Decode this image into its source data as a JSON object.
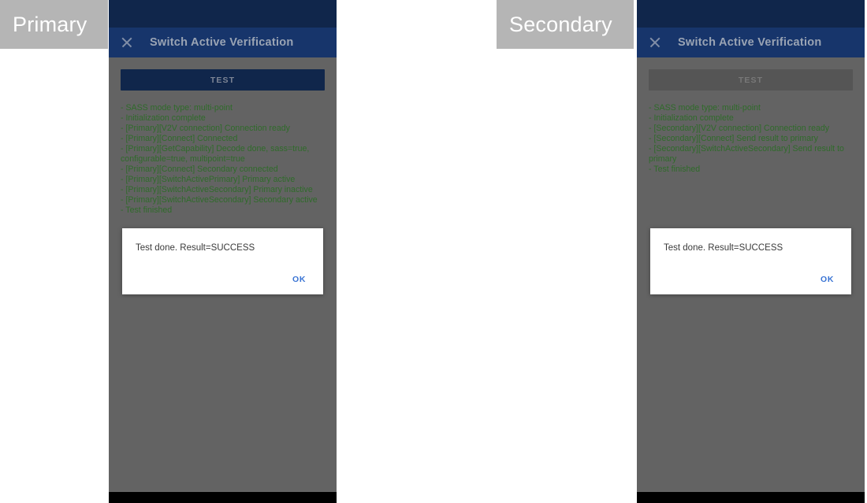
{
  "labels": {
    "primary": "Primary",
    "secondary": "Secondary"
  },
  "colors": {
    "status_bar": "#10264b",
    "app_bar": "#17356b",
    "scrim": "#636363",
    "log_text": "#2f6b2a",
    "accent_ok": "#3a74d4",
    "label_chip": "#b5b5b5",
    "nav_bar": "#000000",
    "button_enabled": "#10264b",
    "button_disabled": "#555555"
  },
  "primary_device": {
    "app_bar": {
      "close_label": "×",
      "title": "Switch Active Verification"
    },
    "test_button": {
      "label": "TEST",
      "state": "enabled"
    },
    "log": "- SASS mode type: multi-point\n- Initialization complete\n- [Primary][V2V connection] Connection ready\n- [Primary][Connect] Connected\n- [Primary][GetCapability] Decode done, sass=true, configurable=true, multipoint=true\n- [Primary][Connect] Secondary connected\n- [Primary][SwitchActivePrimary] Primary active\n- [Primary][SwitchActiveSecondary] Primary inactive\n- [Primary][SwitchActiveSecondary] Secondary active\n- Test finished",
    "dialog": {
      "message": "Test done. Result=SUCCESS",
      "ok_label": "OK"
    }
  },
  "secondary_device": {
    "app_bar": {
      "close_label": "×",
      "title": "Switch Active Verification"
    },
    "test_button": {
      "label": "TEST",
      "state": "disabled"
    },
    "log": "- SASS mode type: multi-point\n- Initialization complete\n- [Secondary][V2V connection] Connection ready\n- [Secondary][Connect] Send result to primary\n- [Secondary][SwitchActiveSecondary] Send result to primary\n- Test finished",
    "dialog": {
      "message": "Test done. Result=SUCCESS",
      "ok_label": "OK"
    }
  }
}
